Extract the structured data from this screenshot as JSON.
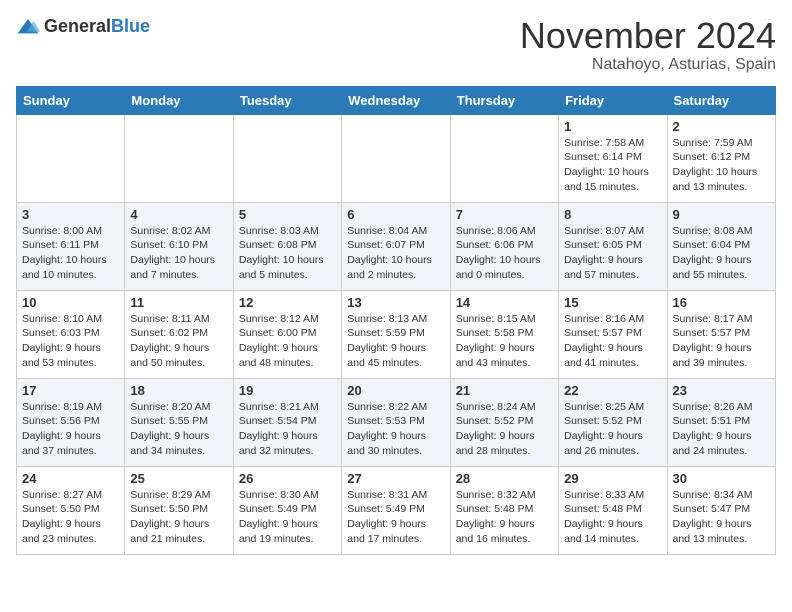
{
  "logo": {
    "text_general": "General",
    "text_blue": "Blue"
  },
  "title": {
    "month": "November 2024",
    "location": "Natahoyo, Asturias, Spain"
  },
  "weekdays": [
    "Sunday",
    "Monday",
    "Tuesday",
    "Wednesday",
    "Thursday",
    "Friday",
    "Saturday"
  ],
  "weeks": [
    [
      {
        "day": "",
        "info": ""
      },
      {
        "day": "",
        "info": ""
      },
      {
        "day": "",
        "info": ""
      },
      {
        "day": "",
        "info": ""
      },
      {
        "day": "",
        "info": ""
      },
      {
        "day": "1",
        "info": "Sunrise: 7:58 AM\nSunset: 6:14 PM\nDaylight: 10 hours\nand 15 minutes."
      },
      {
        "day": "2",
        "info": "Sunrise: 7:59 AM\nSunset: 6:12 PM\nDaylight: 10 hours\nand 13 minutes."
      }
    ],
    [
      {
        "day": "3",
        "info": "Sunrise: 8:00 AM\nSunset: 6:11 PM\nDaylight: 10 hours\nand 10 minutes."
      },
      {
        "day": "4",
        "info": "Sunrise: 8:02 AM\nSunset: 6:10 PM\nDaylight: 10 hours\nand 7 minutes."
      },
      {
        "day": "5",
        "info": "Sunrise: 8:03 AM\nSunset: 6:08 PM\nDaylight: 10 hours\nand 5 minutes."
      },
      {
        "day": "6",
        "info": "Sunrise: 8:04 AM\nSunset: 6:07 PM\nDaylight: 10 hours\nand 2 minutes."
      },
      {
        "day": "7",
        "info": "Sunrise: 8:06 AM\nSunset: 6:06 PM\nDaylight: 10 hours\nand 0 minutes."
      },
      {
        "day": "8",
        "info": "Sunrise: 8:07 AM\nSunset: 6:05 PM\nDaylight: 9 hours\nand 57 minutes."
      },
      {
        "day": "9",
        "info": "Sunrise: 8:08 AM\nSunset: 6:04 PM\nDaylight: 9 hours\nand 55 minutes."
      }
    ],
    [
      {
        "day": "10",
        "info": "Sunrise: 8:10 AM\nSunset: 6:03 PM\nDaylight: 9 hours\nand 53 minutes."
      },
      {
        "day": "11",
        "info": "Sunrise: 8:11 AM\nSunset: 6:02 PM\nDaylight: 9 hours\nand 50 minutes."
      },
      {
        "day": "12",
        "info": "Sunrise: 8:12 AM\nSunset: 6:00 PM\nDaylight: 9 hours\nand 48 minutes."
      },
      {
        "day": "13",
        "info": "Sunrise: 8:13 AM\nSunset: 5:59 PM\nDaylight: 9 hours\nand 45 minutes."
      },
      {
        "day": "14",
        "info": "Sunrise: 8:15 AM\nSunset: 5:58 PM\nDaylight: 9 hours\nand 43 minutes."
      },
      {
        "day": "15",
        "info": "Sunrise: 8:16 AM\nSunset: 5:57 PM\nDaylight: 9 hours\nand 41 minutes."
      },
      {
        "day": "16",
        "info": "Sunrise: 8:17 AM\nSunset: 5:57 PM\nDaylight: 9 hours\nand 39 minutes."
      }
    ],
    [
      {
        "day": "17",
        "info": "Sunrise: 8:19 AM\nSunset: 5:56 PM\nDaylight: 9 hours\nand 37 minutes."
      },
      {
        "day": "18",
        "info": "Sunrise: 8:20 AM\nSunset: 5:55 PM\nDaylight: 9 hours\nand 34 minutes."
      },
      {
        "day": "19",
        "info": "Sunrise: 8:21 AM\nSunset: 5:54 PM\nDaylight: 9 hours\nand 32 minutes."
      },
      {
        "day": "20",
        "info": "Sunrise: 8:22 AM\nSunset: 5:53 PM\nDaylight: 9 hours\nand 30 minutes."
      },
      {
        "day": "21",
        "info": "Sunrise: 8:24 AM\nSunset: 5:52 PM\nDaylight: 9 hours\nand 28 minutes."
      },
      {
        "day": "22",
        "info": "Sunrise: 8:25 AM\nSunset: 5:52 PM\nDaylight: 9 hours\nand 26 minutes."
      },
      {
        "day": "23",
        "info": "Sunrise: 8:26 AM\nSunset: 5:51 PM\nDaylight: 9 hours\nand 24 minutes."
      }
    ],
    [
      {
        "day": "24",
        "info": "Sunrise: 8:27 AM\nSunset: 5:50 PM\nDaylight: 9 hours\nand 23 minutes."
      },
      {
        "day": "25",
        "info": "Sunrise: 8:29 AM\nSunset: 5:50 PM\nDaylight: 9 hours\nand 21 minutes."
      },
      {
        "day": "26",
        "info": "Sunrise: 8:30 AM\nSunset: 5:49 PM\nDaylight: 9 hours\nand 19 minutes."
      },
      {
        "day": "27",
        "info": "Sunrise: 8:31 AM\nSunset: 5:49 PM\nDaylight: 9 hours\nand 17 minutes."
      },
      {
        "day": "28",
        "info": "Sunrise: 8:32 AM\nSunset: 5:48 PM\nDaylight: 9 hours\nand 16 minutes."
      },
      {
        "day": "29",
        "info": "Sunrise: 8:33 AM\nSunset: 5:48 PM\nDaylight: 9 hours\nand 14 minutes."
      },
      {
        "day": "30",
        "info": "Sunrise: 8:34 AM\nSunset: 5:47 PM\nDaylight: 9 hours\nand 13 minutes."
      }
    ]
  ]
}
